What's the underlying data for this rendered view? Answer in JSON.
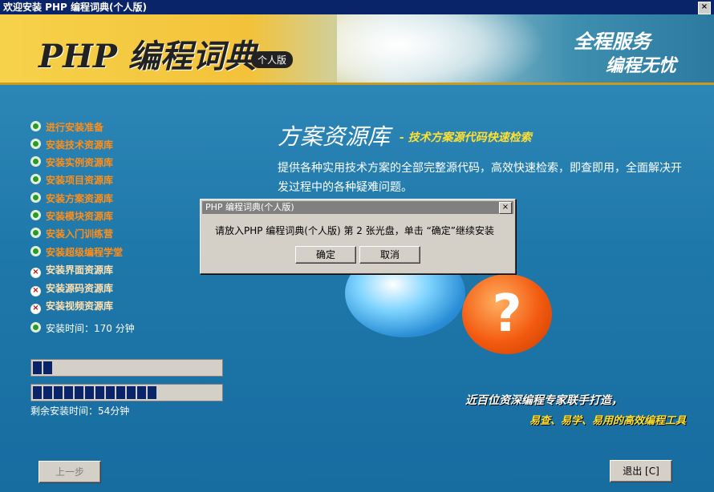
{
  "window": {
    "title": "欢迎安装  PHP  编程词典(个人版)",
    "close_label": "×"
  },
  "banner": {
    "brand": "PHP 编程词典",
    "edition": "个人版",
    "slogan_line1": "全程服务",
    "slogan_line2": "编程无忧"
  },
  "steps": [
    {
      "label": "进行安装准备",
      "status": "done"
    },
    {
      "label": "安装技术资源库",
      "status": "done"
    },
    {
      "label": "安装实例资源库",
      "status": "done"
    },
    {
      "label": "安装项目资源库",
      "status": "done"
    },
    {
      "label": "安装方案资源库",
      "status": "done"
    },
    {
      "label": "安装模块资源库",
      "status": "done"
    },
    {
      "label": "安装入门训练营",
      "status": "done"
    },
    {
      "label": "安装超级编程学堂",
      "status": "done"
    },
    {
      "label": "安装界面资源库",
      "status": "pending"
    },
    {
      "label": "安装源码资源库",
      "status": "pending"
    },
    {
      "label": "安装视频资源库",
      "status": "pending"
    }
  ],
  "install_time": "安装时间：170 分钟",
  "progress": {
    "current_fraction": 0.1,
    "overall_fraction": 0.65
  },
  "remaining_time": "剩余安装时间：54分钟",
  "feature": {
    "title": "方案资源库",
    "subtitle": "- 技术方案源代码快速检索",
    "description": "提供各种实用技术方案的全部完整源代码，高效快速检索，即查即用，全面解决开发过程中的各种疑难问题。"
  },
  "taglines": {
    "line1": "近百位资深编程专家联手打造，",
    "line2": "易查、易学、易用的高效编程工具"
  },
  "buttons": {
    "back": "上一步",
    "exit": "退出 [C]"
  },
  "dialog": {
    "title": "PHP 编程词典(个人版)",
    "close_label": "×",
    "message": "请放入PHP 编程词典(个人版) 第 2 张光盘，单击 “确定”继续安装",
    "ok": "确定",
    "cancel": "取消"
  }
}
